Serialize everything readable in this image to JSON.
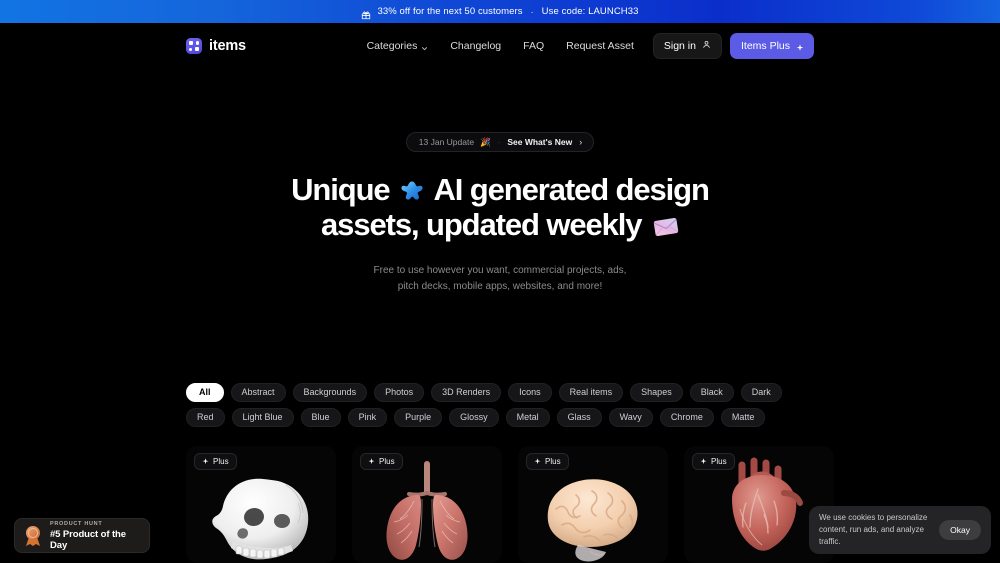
{
  "promo": {
    "icon": "gift-icon",
    "text": "33% off for the next 50 customers",
    "separator": "·",
    "code_text": "Use code: LAUNCH33"
  },
  "header": {
    "brand": "items",
    "nav": [
      {
        "label": "Categories",
        "has_chevron": true
      },
      {
        "label": "Changelog",
        "has_chevron": false
      },
      {
        "label": "FAQ",
        "has_chevron": false
      },
      {
        "label": "Request Asset",
        "has_chevron": false
      }
    ],
    "signin_label": "Sign in",
    "plus_label": "Items Plus"
  },
  "hero": {
    "badge": {
      "date": "13 Jan Update",
      "emoji": "🎉",
      "dot": "·",
      "cta": "See What's New",
      "arrow": "›"
    },
    "headline_line1_a": "Unique",
    "headline_line1_b": "AI generated design",
    "headline_line2": "assets, updated weekly",
    "subtitle_line1": "Free to use however you want, commercial projects, ads,",
    "subtitle_line2": "pitch decks, mobile apps, websites, and more!"
  },
  "filters": {
    "active": "All",
    "chips": [
      "All",
      "Abstract",
      "Backgrounds",
      "Photos",
      "3D Renders",
      "Icons",
      "Real items",
      "Shapes",
      "Black",
      "Dark",
      "Red",
      "Light Blue",
      "Blue",
      "Pink",
      "Purple",
      "Glossy",
      "Metal",
      "Glass",
      "Wavy",
      "Chrome",
      "Matte"
    ]
  },
  "gallery": {
    "badge_label": "Plus",
    "cards": [
      {
        "name": "skull-render"
      },
      {
        "name": "lungs-render"
      },
      {
        "name": "brain-render"
      },
      {
        "name": "heart-render"
      }
    ]
  },
  "product_hunt": {
    "kicker": "PRODUCT HUNT",
    "title": "#5 Product of the Day"
  },
  "cookie": {
    "text": "We use cookies to personalize content, run ads, and analyze traffic.",
    "button": "Okay"
  },
  "colors": {
    "banner_blue": "#1274e3",
    "accent_indigo": "#5b5be6",
    "background": "#000000",
    "chip_bg": "#161618"
  }
}
